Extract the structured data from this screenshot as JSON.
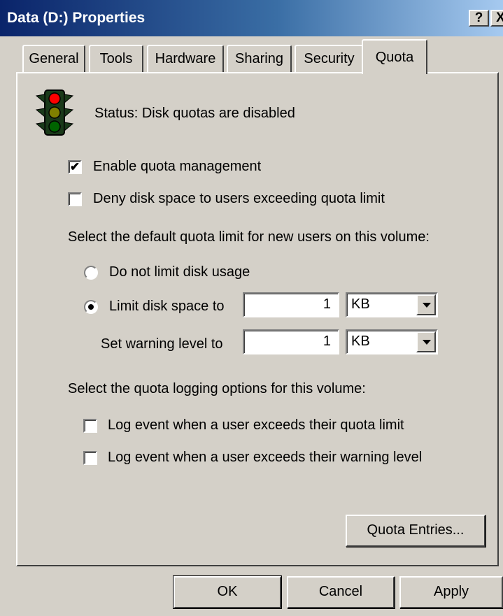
{
  "window": {
    "title": "Data (D:) Properties",
    "help_label": "?",
    "close_label": "X"
  },
  "tabs": [
    {
      "label": "General"
    },
    {
      "label": "Tools"
    },
    {
      "label": "Hardware"
    },
    {
      "label": "Sharing"
    },
    {
      "label": "Security"
    },
    {
      "label": "Quota",
      "active": true
    }
  ],
  "status": {
    "icon": "traffic-light-icon",
    "text": "Status:  Disk quotas are disabled"
  },
  "options": {
    "enable_quota": {
      "label": "Enable quota management",
      "checked": true
    },
    "deny_space": {
      "label": "Deny disk space to users exceeding quota limit",
      "checked": false
    }
  },
  "default_limit": {
    "heading": "Select the default quota limit for new users on this volume:",
    "no_limit": {
      "label": "Do not limit disk usage",
      "selected": false
    },
    "limit": {
      "label": "Limit disk space to",
      "selected": true,
      "value": "1",
      "unit": "KB"
    },
    "warning": {
      "label": "Set warning level to",
      "value": "1",
      "unit": "KB"
    }
  },
  "logging": {
    "heading": "Select the quota logging options for this volume:",
    "log_limit": {
      "label": "Log event when a user exceeds their quota limit",
      "checked": false
    },
    "log_warning": {
      "label": "Log event when a user exceeds their warning level",
      "checked": false
    }
  },
  "buttons": {
    "quota_entries": "Quota Entries...",
    "ok": "OK",
    "cancel": "Cancel",
    "apply": "Apply"
  },
  "colors": {
    "face": "#d4d0c8",
    "title_dark": "#0a246a",
    "title_light": "#a6caf0",
    "light_red": "#ff0000",
    "light_yellow": "#808000",
    "light_green": "#006400"
  }
}
